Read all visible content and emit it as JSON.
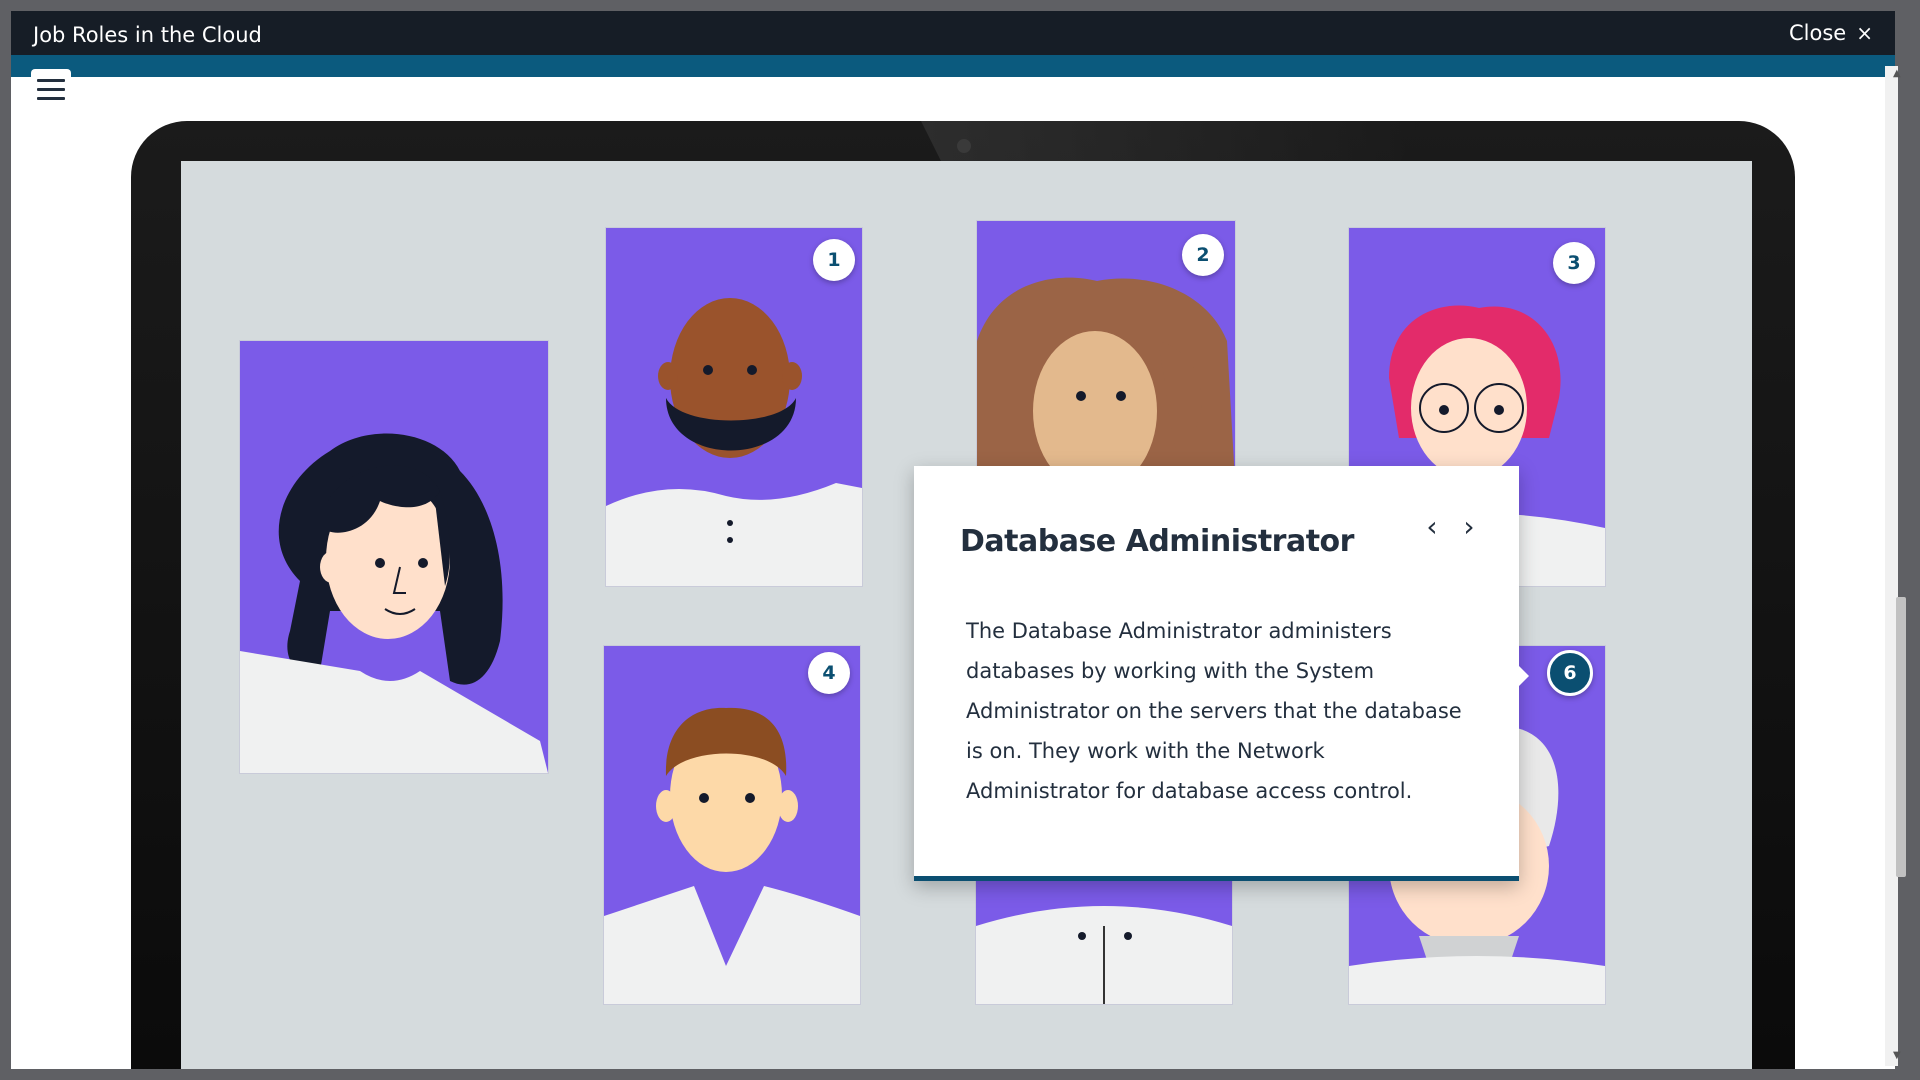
{
  "window": {
    "title": "Job Roles in the Cloud",
    "close_label": "Close",
    "close_icon": "×"
  },
  "menu": {
    "icon": "hamburger-icon"
  },
  "badges": [
    "1",
    "2",
    "3",
    "4",
    "6"
  ],
  "popup": {
    "title": "Database Administrator",
    "prev_icon": "‹",
    "next_icon": "›",
    "body": "The Database Administrator administers databases by working with the System Administrator on the servers that the database is on. They work with the Network Administrator for database access control."
  },
  "colors": {
    "title_bar": "#161d26",
    "accent_strip": "#0b5a7e",
    "card_purple": "#7b5be8",
    "badge_active": "#0b4f71",
    "screen_bg": "#d5dbdd"
  }
}
